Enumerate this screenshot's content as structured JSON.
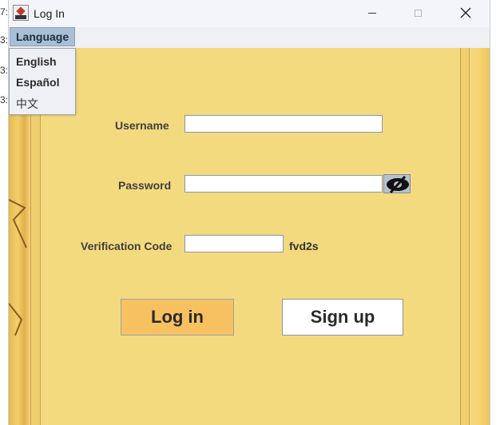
{
  "background_fragments": [
    "7:",
    "3:",
    "3:",
    "3:"
  ],
  "window": {
    "title": "Log In"
  },
  "menu": {
    "language_label": "Language",
    "options": [
      "English",
      "Español",
      "中文"
    ]
  },
  "form": {
    "username_label": "Username",
    "username_value": "",
    "password_label": "Password",
    "password_value": "",
    "verification_label": "Verification Code",
    "verification_value": "",
    "captcha_code": "fvd2s"
  },
  "buttons": {
    "login_label": "Log in",
    "signup_label": "Sign up"
  },
  "colors": {
    "panel_bg": "#f4da7e",
    "login_button": "#f7c162",
    "menu_highlight": "#a9bfd6"
  },
  "icons": {
    "app": "app-icon",
    "minimize": "minimize-icon",
    "maximize": "maximize-icon",
    "close": "close-icon",
    "show_password": "eye-slash-icon"
  }
}
